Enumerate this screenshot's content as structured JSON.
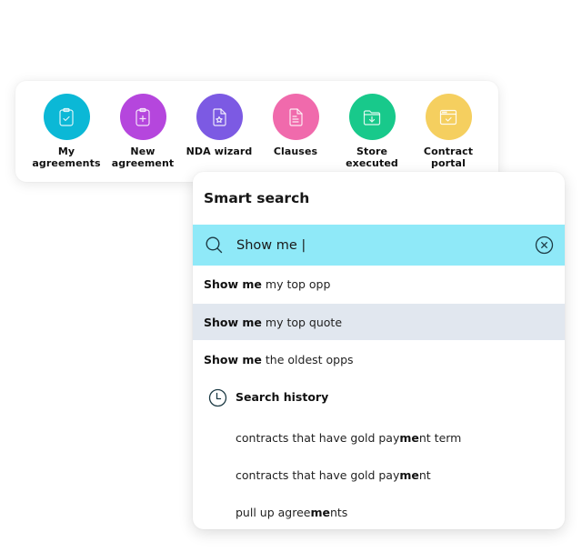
{
  "toolbar": {
    "items": [
      {
        "label_line1": "My",
        "label_line2": "agreements",
        "icon": "clipboard-check-icon",
        "color": "#0bb8d6"
      },
      {
        "label_line1": "New",
        "label_line2": "agreement",
        "icon": "clipboard-plus-icon",
        "color": "#b546dd"
      },
      {
        "label_line1": "NDA wizard",
        "label_line2": "",
        "icon": "document-star-icon",
        "color": "#7c5ae3"
      },
      {
        "label_line1": "Clauses",
        "label_line2": "",
        "icon": "document-lines-icon",
        "color": "#f06aac"
      },
      {
        "label_line1": "Store",
        "label_line2": "executed",
        "icon": "folder-download-icon",
        "color": "#18c98b"
      },
      {
        "label_line1": "Contract",
        "label_line2": "portal",
        "icon": "browser-check-icon",
        "color": "#f5cf5f"
      }
    ]
  },
  "smart_search": {
    "title": "Smart search",
    "query": "Show me |",
    "search_bar_color": "#8fe9f8",
    "suggestions": [
      {
        "bold": "Show me",
        "rest": "my top opp",
        "active": false
      },
      {
        "bold": "Show me",
        "rest": "my top quote",
        "active": true
      },
      {
        "bold": "Show me",
        "rest": "the oldest opps",
        "active": false
      }
    ],
    "history": {
      "title": "Search history",
      "items": [
        {
          "before": "contracts that have gold pay",
          "match": "me",
          "after": "nt term"
        },
        {
          "before": "contracts that have gold pay",
          "match": "me",
          "after": "nt"
        },
        {
          "before": "pull up agree",
          "match": "me",
          "after": "nts"
        }
      ]
    }
  }
}
